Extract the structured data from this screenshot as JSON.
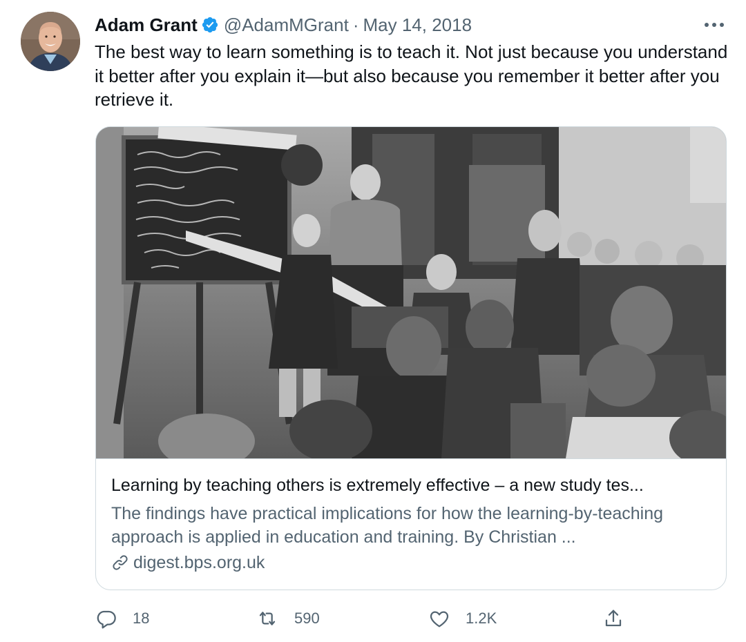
{
  "tweet": {
    "author_name": "Adam Grant",
    "handle": "@AdamMGrant",
    "separator": "·",
    "date": "May 14, 2018",
    "text": "The best way to learn something is to teach it. Not just because you understand it better after you explain it—but also because you remember it better after you retrieve it."
  },
  "card": {
    "title": "Learning by teaching others is extremely effective – a new study tes...",
    "description": "The findings have practical implications for how the learning-by-teaching approach is applied in education and training. By Christian ...",
    "domain": "digest.bps.org.uk"
  },
  "actions": {
    "replies": "18",
    "retweets": "590",
    "likes": "1.2K"
  },
  "colors": {
    "text_primary": "#0f1419",
    "text_secondary": "#536471",
    "verified_blue": "#1d9bf0",
    "border": "#cfd9de"
  },
  "icons": {
    "verified": "verified-badge-icon",
    "more": "more-dots-icon",
    "link": "link-icon",
    "reply": "reply-icon",
    "retweet": "retweet-icon",
    "like": "heart-icon",
    "share": "share-icon"
  }
}
